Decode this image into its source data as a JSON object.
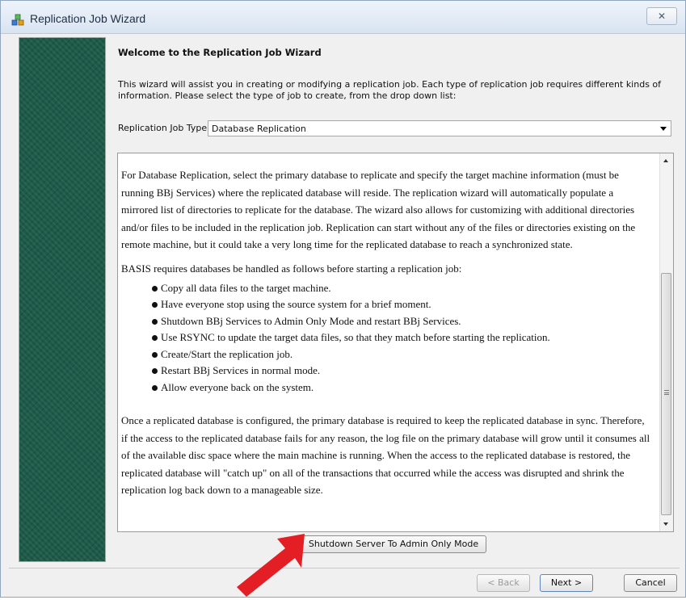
{
  "window": {
    "title": "Replication Job Wizard",
    "close_glyph": "✕"
  },
  "heading": "Welcome to the Replication Job Wizard",
  "intro_line1": "This wizard will assist you in creating or modifying a replication job. Each type of replication job requires different kinds of",
  "intro_line2": "information. Please select the type of job to create, from the drop down list:",
  "job_type": {
    "label": "Replication Job Type:",
    "selected": "Database Replication"
  },
  "description": {
    "paragraph1": "For Database Replication, select the primary database to replicate and specify the target machine information (must be running BBj Services) where the replicated database will reside. The replication wizard will automatically populate a mirrored list of directories to replicate for the database. The wizard also allows for customizing with additional directories and/or files to be included in the replication job. Replication can start without any of the files or directories existing on the remote machine, but it could take a very long time for the replicated database to reach a synchronized state.",
    "paragraph2": "BASIS requires databases be handled as follows before starting a replication job:",
    "steps": [
      "Copy all data files to the target machine.",
      "Have everyone stop using the source system for a brief moment.",
      "Shutdown BBj Services to Admin Only Mode and restart BBj Services.",
      "Use RSYNC to update the target data files, so that they match before starting the replication.",
      "Create/Start the replication job.",
      "Restart BBj Services in normal mode.",
      "Allow everyone back on the system."
    ],
    "paragraph3": "Once a replicated database is configured, the primary database is required to keep the replicated database in sync. Therefore, if the access to the replicated database fails for any reason, the log file on the primary database will grow until it consumes all of the available disc space where the main machine is running. When the access to the replicated database is restored, the replicated database will \"catch up\" on all of the transactions that occurred while the access was disrupted and shrink the replication log back down to a manageable size."
  },
  "buttons": {
    "shutdown": "Shutdown Server To Admin Only Mode",
    "back": "< Back",
    "next": "Next >",
    "cancel": "Cancel"
  },
  "colors": {
    "sidebar": "#1d5a48",
    "annotation_arrow": "#e31e24"
  },
  "icons": {
    "app": "replication-app-icon",
    "annotation": "red-pointer-arrow"
  }
}
